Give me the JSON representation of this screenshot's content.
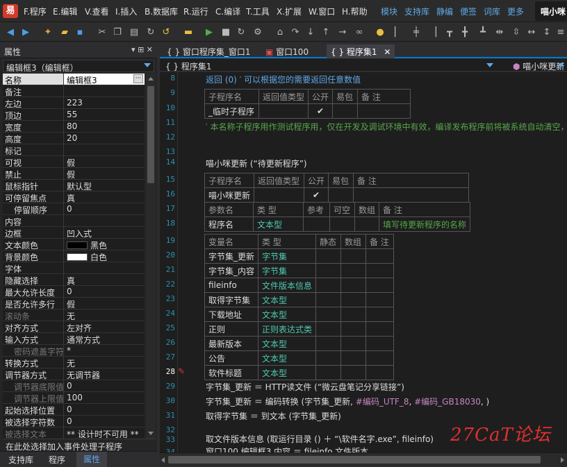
{
  "menubar": {
    "items": [
      {
        "key": "F",
        "label": "F.程序"
      },
      {
        "key": "E",
        "label": "E.编辑"
      },
      {
        "key": "V",
        "label": "V.查看"
      },
      {
        "key": "I",
        "label": "I.插入"
      },
      {
        "key": "B",
        "label": "B.数据库"
      },
      {
        "key": "R",
        "label": "R.运行"
      },
      {
        "key": "C",
        "label": "C.编译"
      },
      {
        "key": "T",
        "label": "T.工具"
      },
      {
        "key": "X",
        "label": "X.扩展"
      },
      {
        "key": "W",
        "label": "W.窗口"
      },
      {
        "key": "H",
        "label": "H.帮助"
      }
    ],
    "quick_tabs": [
      "模块",
      "支持库",
      "静编",
      "便签",
      "词库",
      "更多"
    ],
    "app_title": "喵小咪"
  },
  "toolbar": {
    "icons": [
      "back-icon",
      "forward-icon",
      "new-icon",
      "open-icon",
      "save-icon",
      "cut-icon",
      "copy-icon",
      "paste-icon",
      "redo-icon",
      "undo-icon",
      "folder-icon",
      "run-icon",
      "stop-icon",
      "restart-icon",
      "compile-icon",
      "network-icon",
      "step-icon",
      "step-into-icon",
      "step-out-icon",
      "arrow-icon",
      "link-icon",
      "bulb-icon",
      "align-left-icon",
      "align-center-icon",
      "align-right-icon",
      "align-top-icon",
      "align-middle-icon",
      "align-bottom-icon",
      "space-h-icon",
      "space-v-icon",
      "same-width-icon",
      "same-height-icon",
      "distribute-icon"
    ]
  },
  "properties": {
    "title": "属性",
    "pin": "▾ ᛫ ✕",
    "selected_object": "编辑框3（编辑框）",
    "rows": [
      {
        "name": "名称",
        "value": "编辑框3",
        "selected": true,
        "button": "···"
      },
      {
        "name": "备注",
        "value": ""
      },
      {
        "name": "左边",
        "value": "223"
      },
      {
        "name": "顶边",
        "value": "55"
      },
      {
        "name": "宽度",
        "value": "80"
      },
      {
        "name": "高度",
        "value": "20"
      },
      {
        "name": "标记",
        "value": ""
      },
      {
        "name": "可视",
        "value": "假"
      },
      {
        "name": "禁止",
        "value": "假"
      },
      {
        "name": "鼠标指针",
        "value": "默认型"
      },
      {
        "name": "可停留焦点",
        "value": "真"
      },
      {
        "name": "停留顺序",
        "value": "0",
        "indent": true
      },
      {
        "name": "内容",
        "value": ""
      },
      {
        "name": "边框",
        "value": "凹入式"
      },
      {
        "name": "文本颜色",
        "value": "黑色",
        "swatch": "#000000"
      },
      {
        "name": "背景颜色",
        "value": "白色",
        "swatch": "#ffffff"
      },
      {
        "name": "字体",
        "value": ""
      },
      {
        "name": "隐藏选择",
        "value": "真"
      },
      {
        "name": "最大允许长度",
        "value": "0"
      },
      {
        "name": "是否允许多行",
        "value": "假"
      },
      {
        "name": "滚动条",
        "value": "无",
        "dim": true
      },
      {
        "name": "对齐方式",
        "value": "左对齐"
      },
      {
        "name": "输入方式",
        "value": "通常方式"
      },
      {
        "name": "密码遮盖字符",
        "value": "*",
        "dim": true,
        "indent": true
      },
      {
        "name": "转换方式",
        "value": "无"
      },
      {
        "name": "调节器方式",
        "value": "无调节器"
      },
      {
        "name": "调节器底限值",
        "value": "0",
        "dim": true,
        "indent": true
      },
      {
        "name": "调节器上限值",
        "value": "100",
        "dim": true,
        "indent": true
      },
      {
        "name": "起始选择位置",
        "value": "0"
      },
      {
        "name": "被选择字符数",
        "value": "0"
      },
      {
        "name": "被选择文本",
        "value": "** 设计时不可用 **",
        "dim": true
      }
    ],
    "hint": "在此处选择加入事件处理子程序",
    "bottom_tabs": [
      "支持库",
      "程序",
      "属性"
    ]
  },
  "editor": {
    "tabs": [
      {
        "icon": "{ }",
        "label": "窗口程序集_窗口1",
        "active": false
      },
      {
        "icon": "▣",
        "label": "窗口100",
        "active": false
      },
      {
        "icon": "{ }",
        "label": "程序集1",
        "active": true,
        "close": "✕"
      }
    ],
    "header_left": "程序集1",
    "header_right": "喵小咪更新",
    "line_numbers": [
      "8",
      "9",
      "10",
      "11",
      "12",
      "13",
      "14",
      "15",
      "16",
      "17",
      "18",
      "19",
      "20",
      "21",
      "22",
      "23",
      "24",
      "25",
      "26",
      "27",
      "28",
      "29",
      "30",
      "31",
      "32",
      "33",
      "34"
    ],
    "current_line": "28",
    "line8": "返回 (0)  ′ 可以根据您的需要返回任意数值",
    "sub1_table": {
      "header": [
        "子程序名",
        "返回值类型",
        "公开",
        "易包",
        "备 注"
      ],
      "row": [
        "_临时子程序",
        "",
        "✔",
        "",
        ""
      ]
    },
    "line11": "′ 本名称子程序用作测试程序用，仅在开发及调试环境中有效，编译发布程序前将被系统自动清空，",
    "line14": "喵小咪更新 (“待更新程序”)",
    "sub2_table": {
      "header": [
        "子程序名",
        "返回值类型",
        "公开",
        "易包",
        "备 注"
      ],
      "row": [
        "喵小咪更新",
        "",
        "✔",
        "",
        ""
      ],
      "param_header": [
        "参数名",
        "类 型",
        "参考",
        "可空",
        "数组",
        "备 注"
      ],
      "param_row": [
        "程序名",
        "文本型",
        "",
        "",
        "",
        "填写待更新程序的名称"
      ]
    },
    "var_table": {
      "header": [
        "变量名",
        "类 型",
        "静态",
        "数组",
        "备 注"
      ],
      "rows": [
        [
          "字节集_更新",
          "字节集"
        ],
        [
          "字节集_内容",
          "字节集"
        ],
        [
          "fileinfo",
          "文件版本信息"
        ],
        [
          "取得字节集",
          "文本型"
        ],
        [
          "下载地址",
          "文本型"
        ],
        [
          "正则",
          "正则表达式类"
        ],
        [
          "最新版本",
          "文本型"
        ],
        [
          "公告",
          "文本型"
        ],
        [
          "软件标题",
          "文本型"
        ]
      ]
    },
    "line29_a": "字节集_更新 ＝ HTTP读文件 (“微云盘笔记分享链接”)",
    "line30_a": "字节集_更新 ＝ 编码转换 (字节集_更新, ",
    "line30_b": "#编码_UTF_8",
    "line30_c": ", ",
    "line30_d": "#编码_GB18030",
    "line30_e": ", )",
    "line31": "取得字节集 ＝ 到文本 (字节集_更新)",
    "line33": "取文件版本信息 (取运行目录 () ＋ “\\软件名字.exe”, fileinfo)",
    "line34": "窗口100.编辑框3.内容 ＝ fileinfo.文件版本"
  },
  "watermark": "27CaT论坛"
}
